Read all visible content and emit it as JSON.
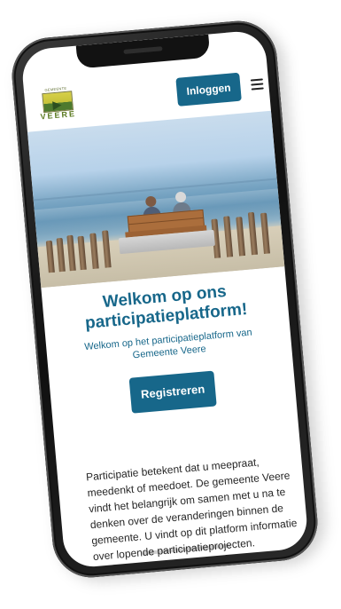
{
  "logo": {
    "small_text": "GEMEENTE",
    "name": "VEERE"
  },
  "header": {
    "login_label": "Inloggen"
  },
  "hero": {
    "alt": "Beach scene with bench"
  },
  "content": {
    "title": "Welkom op ons participatieplatform!",
    "subtitle": "Welkom op het participatieplatform van Gemeente Veere",
    "register_label": "Registreren",
    "body": "Participatie betekent dat u meepraat, meedenkt of meedoet. De gemeente Veere vindt het belangrijk om samen met u na te denken over de veranderingen binnen de gemeente. U vindt op dit platform informatie over lopende participatieprojecten."
  },
  "colors": {
    "accent": "#17678a",
    "logo_green": "#5b7a20"
  },
  "icons": {
    "menu": "hamburger-icon"
  }
}
